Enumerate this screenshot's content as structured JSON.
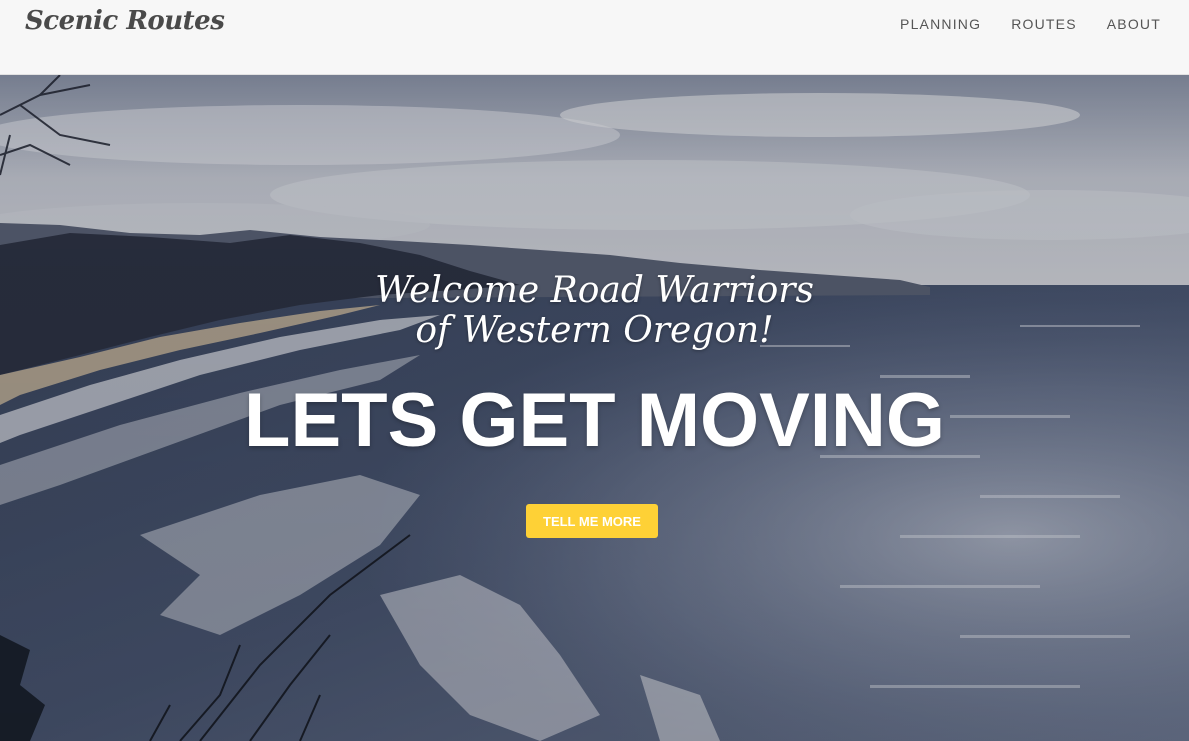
{
  "navbar": {
    "brand": "Scenic Routes",
    "links": [
      {
        "label": "PLANNING"
      },
      {
        "label": "ROUTES"
      },
      {
        "label": "ABOUT"
      }
    ]
  },
  "hero": {
    "welcome_line1": "Welcome Road Warriors",
    "welcome_line2": "of Western Oregon!",
    "headline": "LETS GET MOVING",
    "cta_label": "TELL ME MORE"
  },
  "colors": {
    "navbar_bg": "#f7f7f7",
    "cta_bg": "#fed136",
    "hero_text": "#ffffff"
  }
}
